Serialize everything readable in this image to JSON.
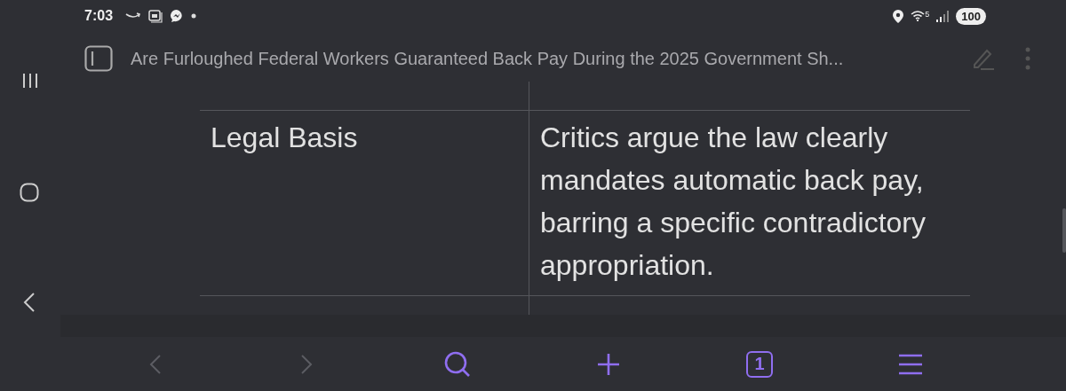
{
  "status_bar": {
    "time": "7:03",
    "wifi_label": "5",
    "battery": "100"
  },
  "title_bar": {
    "title": "Are Furloughed Federal Workers Guaranteed Back Pay During the 2025 Government Sh..."
  },
  "table": {
    "rows": [
      {
        "cells": [
          "Legal Basis",
          "Critics argue the law clearly mandates automatic back pay, barring a specific contradictory appropriation."
        ]
      }
    ]
  },
  "toolbar": [
    {
      "kind": "back",
      "disabled": true
    },
    {
      "kind": "forward",
      "disabled": true
    },
    {
      "kind": "search",
      "disabled": false
    },
    {
      "kind": "add",
      "disabled": false
    },
    {
      "kind": "tabs",
      "disabled": false,
      "count": "1"
    },
    {
      "kind": "menu",
      "disabled": false
    }
  ]
}
